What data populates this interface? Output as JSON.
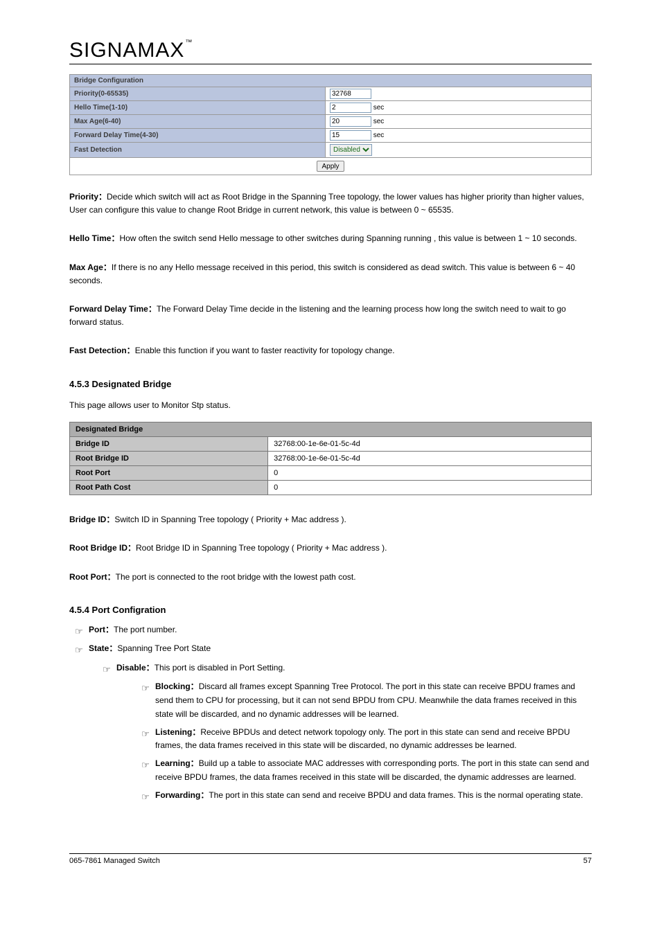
{
  "logo_text": "SIGNAMAX",
  "bridge_config": {
    "header": "Bridge Configuration",
    "rows": [
      {
        "label": "Priority(0-65535)",
        "value": "32768",
        "suffix": ""
      },
      {
        "label": "Hello Time(1-10)",
        "value": "2",
        "suffix": "sec"
      },
      {
        "label": "Max Age(6-40)",
        "value": "20",
        "suffix": "sec"
      },
      {
        "label": "Forward Delay Time(4-30)",
        "value": "15",
        "suffix": "sec"
      }
    ],
    "fast_detection_label": "Fast Detection",
    "fast_detection_value": "Disabled",
    "apply_label": "Apply"
  },
  "param_explain": {
    "priority": {
      "label": "Priority：",
      "text": "Decide which switch will act as Root Bridge in the Spanning Tree topology, the lower values has higher priority than higher values, User can configure this value to change Root Bridge in current network, this value is between 0 ~ 65535."
    },
    "hello": {
      "label": "Hello Time：",
      "text": "How often the switch send Hello message to other switches during Spanning running , this value is between 1 ~ 10 seconds."
    },
    "maxage": {
      "label": "Max Age：",
      "text": "If there is no any Hello message received in this period, this switch is considered as dead switch. This value is between 6 ~ 40 seconds."
    },
    "fwd": {
      "label": "Forward Delay Time：",
      "text": "The Forward Delay Time decide in the listening and the learning process how long the switch need to wait to go forward status."
    },
    "fast": {
      "label": "Fast Detection：",
      "text": "Enable this function if you want to faster reactivity for topology change."
    }
  },
  "designated_section_title": "4.5.3 Designated Bridge",
  "designated_intro": "This page allows user to Monitor Stp status.",
  "designated": {
    "header": "Designated Bridge",
    "bridge_id_label": "Bridge ID",
    "bridge_id_value": "32768:00-1e-6e-01-5c-4d",
    "root_bridge_id_label": "Root Bridge ID",
    "root_bridge_id_value": "32768:00-1e-6e-01-5c-4d",
    "root_port_label": "Root Port",
    "root_port_value": "0",
    "root_path_cost_label": "Root Path Cost",
    "root_path_cost_value": "0"
  },
  "db_explain": {
    "bridge_id": {
      "label": "Bridge ID：",
      "text": "Switch ID in Spanning Tree topology ( Priority + Mac address )."
    },
    "root_bridge_id": {
      "label": "Root Bridge ID：",
      "text": "Root Bridge ID in Spanning Tree topology ( Priority + Mac address )."
    },
    "root_port": {
      "label": "Root Port：",
      "text": "The port is connected to the root bridge with the lowest path cost."
    }
  },
  "port_section_title": "4.5.4 Port Configration",
  "port_bullets": {
    "port": {
      "label": "Port：",
      "text": "The port number."
    },
    "state": {
      "label": "State：",
      "text": "Spanning Tree Port State"
    },
    "disable": {
      "label": "Disable：",
      "text": "This port is disabled in Port Setting."
    },
    "block": {
      "label": "Blocking：",
      "text": "Discard all frames except Spanning Tree Protocol. The port in this state can receive BPDU frames and send them to CPU for processing, but it can not send BPDU from CPU. Meanwhile the data frames received in this state will be discarded, and no dynamic addresses will be learned."
    },
    "listen": {
      "label": "Listening：",
      "text": "Receive BPDUs and detect network topology only. The port in this state can send and receive BPDU frames, the data frames received in this state will be discarded, no dynamic addresses be learned."
    },
    "learn": {
      "label": "Learning：",
      "text": "Build up a table to associate MAC addresses with corresponding ports. The port in this state can send and receive BPDU frames, the data frames received in this state will be discarded, the dynamic addresses are learned."
    },
    "forward": {
      "label": "Forwarding：",
      "text": "The port in this state can send and receive BPDU and data frames. This is the normal operating state."
    }
  },
  "footer": {
    "left": "065-7861 Managed Switch",
    "right": "57"
  }
}
